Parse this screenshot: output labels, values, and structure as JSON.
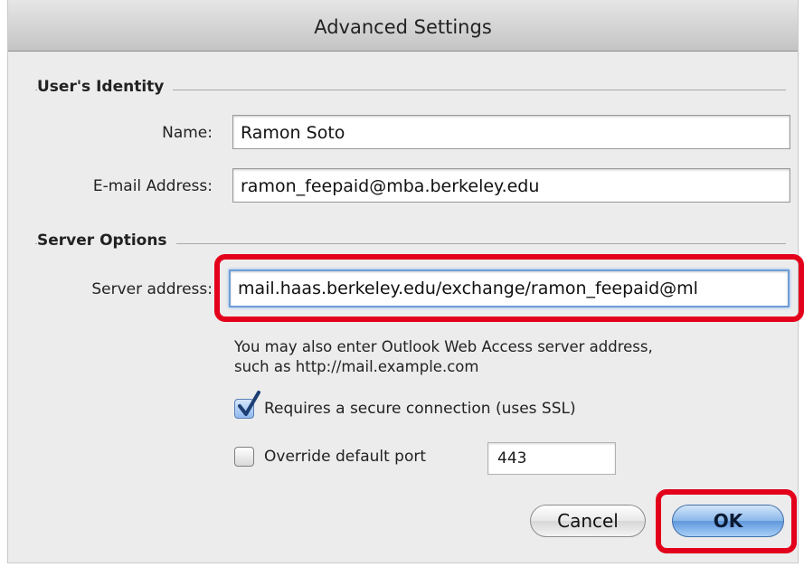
{
  "window": {
    "title": "Advanced Settings"
  },
  "identity": {
    "section_title": "User's Identity",
    "name_label": "Name:",
    "name_value": "Ramon Soto",
    "email_label": "E-mail Address:",
    "email_value": "ramon_feepaid@mba.berkeley.edu"
  },
  "server": {
    "section_title": "Server Options",
    "address_label": "Server address:",
    "address_value": "mail.haas.berkeley.edu/exchange/ramon_feepaid@ml",
    "help_line1": "You may also enter Outlook Web Access server address,",
    "help_line2": "such as http://mail.example.com",
    "ssl_label": "Requires a secure connection (uses SSL)",
    "ssl_checked": true,
    "override_label": "Override default port",
    "override_checked": false,
    "port_value": "443"
  },
  "buttons": {
    "cancel_label": "Cancel",
    "ok_label": "OK"
  },
  "colors": {
    "highlight": "#e3001b",
    "accent": "#5e97dc"
  }
}
